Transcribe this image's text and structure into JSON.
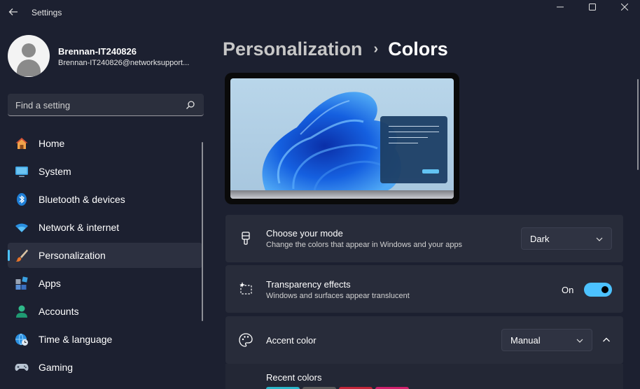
{
  "window": {
    "title": "Settings"
  },
  "profile": {
    "name": "Brennan-IT240826",
    "email": "Brennan-IT240826@networksupport..."
  },
  "search": {
    "placeholder": "Find a setting"
  },
  "sidebar": {
    "items": [
      {
        "label": "Home",
        "icon": "home-icon",
        "active": false
      },
      {
        "label": "System",
        "icon": "system-icon",
        "active": false
      },
      {
        "label": "Bluetooth & devices",
        "icon": "bluetooth-icon",
        "active": false
      },
      {
        "label": "Network & internet",
        "icon": "wifi-icon",
        "active": false
      },
      {
        "label": "Personalization",
        "icon": "paintbrush-icon",
        "active": true
      },
      {
        "label": "Apps",
        "icon": "apps-icon",
        "active": false
      },
      {
        "label": "Accounts",
        "icon": "accounts-icon",
        "active": false
      },
      {
        "label": "Time & language",
        "icon": "globe-clock-icon",
        "active": false
      },
      {
        "label": "Gaming",
        "icon": "gamepad-icon",
        "active": false
      }
    ]
  },
  "breadcrumb": {
    "parent": "Personalization",
    "separator": "›",
    "current": "Colors"
  },
  "settings": {
    "mode": {
      "title": "Choose your mode",
      "description": "Change the colors that appear in Windows and your apps",
      "value": "Dark"
    },
    "transparency": {
      "title": "Transparency effects",
      "description": "Windows and surfaces appear translucent",
      "state_label": "On",
      "enabled": true
    },
    "accent": {
      "title": "Accent color",
      "value": "Manual",
      "expanded": true
    },
    "recent": {
      "label": "Recent colors",
      "swatches": [
        "#2bb6c9",
        "#5a5a5a",
        "#c4263a",
        "#d1206c"
      ]
    }
  },
  "colors": {
    "accent": "#4cc2ff",
    "background": "#1c2030",
    "card": "#282c3a"
  }
}
